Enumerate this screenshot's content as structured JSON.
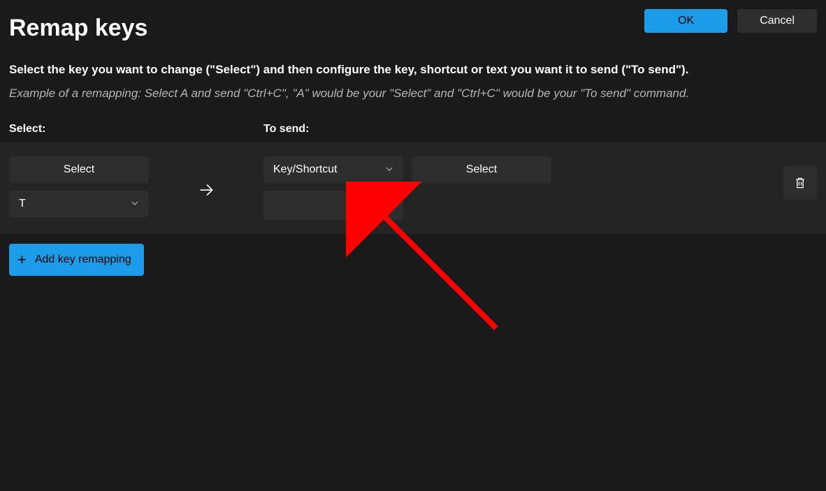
{
  "title": "Remap keys",
  "buttons": {
    "ok": "OK",
    "cancel": "Cancel",
    "add_remapping": "Add key remapping"
  },
  "description": {
    "main": "Select the key you want to change (\"Select\") and then configure the key, shortcut or text you want it to send (\"To send\").",
    "example": "Example of a remapping: Select A and send \"Ctrl+C\", \"A\" would be your \"Select\" and \"Ctrl+C\" would be your \"To send\" command."
  },
  "columns": {
    "select": "Select:",
    "to_send": "To send:"
  },
  "remapping": {
    "select_button": "Select",
    "key_dropdown": "T",
    "type_dropdown": "Key/Shortcut",
    "target_select": "Select"
  }
}
